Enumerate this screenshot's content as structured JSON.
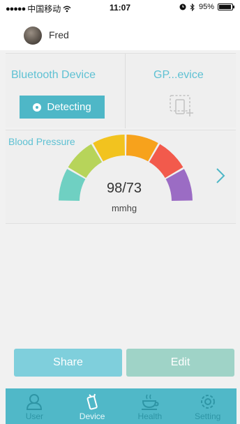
{
  "status_bar": {
    "carrier": "中国移动",
    "time": "11:07",
    "battery_percent": "95%",
    "battery_level": 0.95
  },
  "header": {
    "user_name": "Fred"
  },
  "devices": {
    "bluetooth_title": "Bluetooth Device",
    "detect_label": "Detecting",
    "gps_title": "GP...evice",
    "gps_icon": "add-device-icon"
  },
  "blood_pressure": {
    "title": "Blood Pressure",
    "value": "98/73",
    "unit": "mmhg",
    "gauge_colors": [
      "#6fd0c2",
      "#b7d45a",
      "#f2c31f",
      "#f7a21c",
      "#f25a4c",
      "#9b6cc4"
    ]
  },
  "actions": {
    "share_label": "Share",
    "edit_label": "Edit"
  },
  "tabbar": {
    "tabs": [
      {
        "label": "User",
        "icon": "user-icon"
      },
      {
        "label": "Device",
        "icon": "device-icon"
      },
      {
        "label": "Health",
        "icon": "health-icon"
      },
      {
        "label": "Setting",
        "icon": "gear-icon"
      }
    ],
    "active": "Device"
  }
}
